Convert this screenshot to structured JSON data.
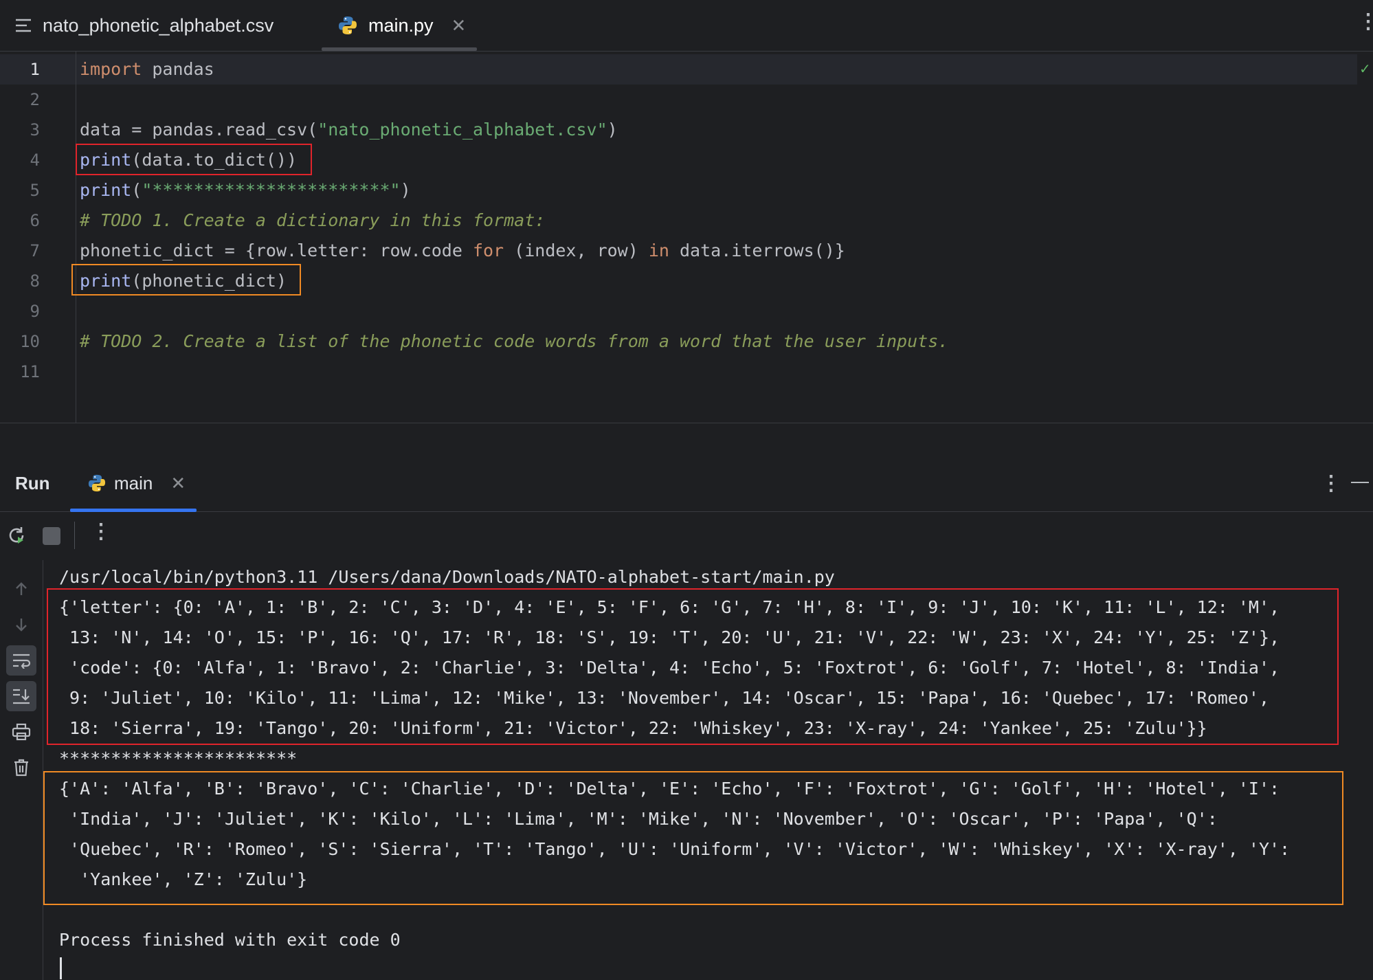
{
  "tabs": [
    {
      "label": "nato_phonetic_alphabet.csv",
      "icon": "text-file-icon"
    },
    {
      "label": "main.py",
      "icon": "python-icon",
      "active": true
    }
  ],
  "editor": {
    "line_numbers": [
      "1",
      "2",
      "3",
      "4",
      "5",
      "6",
      "7",
      "8",
      "9",
      "10",
      "11"
    ],
    "lines": [
      [
        {
          "t": "import",
          "c": "kw"
        },
        {
          "t": " pandas",
          "c": ""
        }
      ],
      [],
      [
        {
          "t": "data = pandas.read_csv(",
          "c": ""
        },
        {
          "t": "\"nato_phonetic_alphabet.csv\"",
          "c": "str"
        },
        {
          "t": ")",
          "c": ""
        }
      ],
      [
        {
          "t": "print",
          "c": "fn"
        },
        {
          "t": "(data.to_dict())",
          "c": ""
        }
      ],
      [
        {
          "t": "print",
          "c": "fn"
        },
        {
          "t": "(",
          "c": ""
        },
        {
          "t": "\"***********************\"",
          "c": "str"
        },
        {
          "t": ")",
          "c": ""
        }
      ],
      [
        {
          "t": "# TODO 1. Create a dictionary in this format:",
          "c": "cmt"
        }
      ],
      [
        {
          "t": "phonetic_dict = {row.letter: row.code ",
          "c": ""
        },
        {
          "t": "for",
          "c": "kw"
        },
        {
          "t": " (index, row) ",
          "c": ""
        },
        {
          "t": "in",
          "c": "kw"
        },
        {
          "t": " data.iterrows()}",
          "c": ""
        }
      ],
      [
        {
          "t": "print",
          "c": "fn"
        },
        {
          "t": "(phonetic_dict)",
          "c": ""
        }
      ],
      [],
      [
        {
          "t": "# TODO 2. Create a list of the phonetic code words from a word that the user inputs.",
          "c": "cmt"
        }
      ],
      []
    ]
  },
  "run_panel": {
    "title": "Run",
    "tab_label": "main",
    "console_lines": [
      "/usr/local/bin/python3.11 /Users/dana/Downloads/NATO-alphabet-start/main.py",
      "{'letter': {0: 'A', 1: 'B', 2: 'C', 3: 'D', 4: 'E', 5: 'F', 6: 'G', 7: 'H', 8: 'I', 9: 'J', 10: 'K', 11: 'L', 12: 'M',",
      " 13: 'N', 14: 'O', 15: 'P', 16: 'Q', 17: 'R', 18: 'S', 19: 'T', 20: 'U', 21: 'V', 22: 'W', 23: 'X', 24: 'Y', 25: 'Z'},",
      " 'code': {0: 'Alfa', 1: 'Bravo', 2: 'Charlie', 3: 'Delta', 4: 'Echo', 5: 'Foxtrot', 6: 'Golf', 7: 'Hotel', 8: 'India',",
      " 9: 'Juliet', 10: 'Kilo', 11: 'Lima', 12: 'Mike', 13: 'November', 14: 'Oscar', 15: 'Papa', 16: 'Quebec', 17: 'Romeo',",
      " 18: 'Sierra', 19: 'Tango', 20: 'Uniform', 21: 'Victor', 22: 'Whiskey', 23: 'X-ray', 24: 'Yankee', 25: 'Zulu'}}",
      "***********************",
      "{'A': 'Alfa', 'B': 'Bravo', 'C': 'Charlie', 'D': 'Delta', 'E': 'Echo', 'F': 'Foxtrot', 'G': 'Golf', 'H': 'Hotel', 'I':",
      " 'India', 'J': 'Juliet', 'K': 'Kilo', 'L': 'Lima', 'M': 'Mike', 'N': 'November', 'O': 'Oscar', 'P': 'Papa', 'Q':",
      " 'Quebec', 'R': 'Romeo', 'S': 'Sierra', 'T': 'Tango', 'U': 'Uniform', 'V': 'Victor', 'W': 'Whiskey', 'X': 'X-ray', 'Y':",
      "  'Yankee', 'Z': 'Zulu'}",
      "",
      "Process finished with exit code 0"
    ]
  },
  "colors": {
    "background": "#1e1f22",
    "highlight_red": "#e0242b",
    "highlight_orange": "#f08a24",
    "accent": "#3574f0"
  }
}
